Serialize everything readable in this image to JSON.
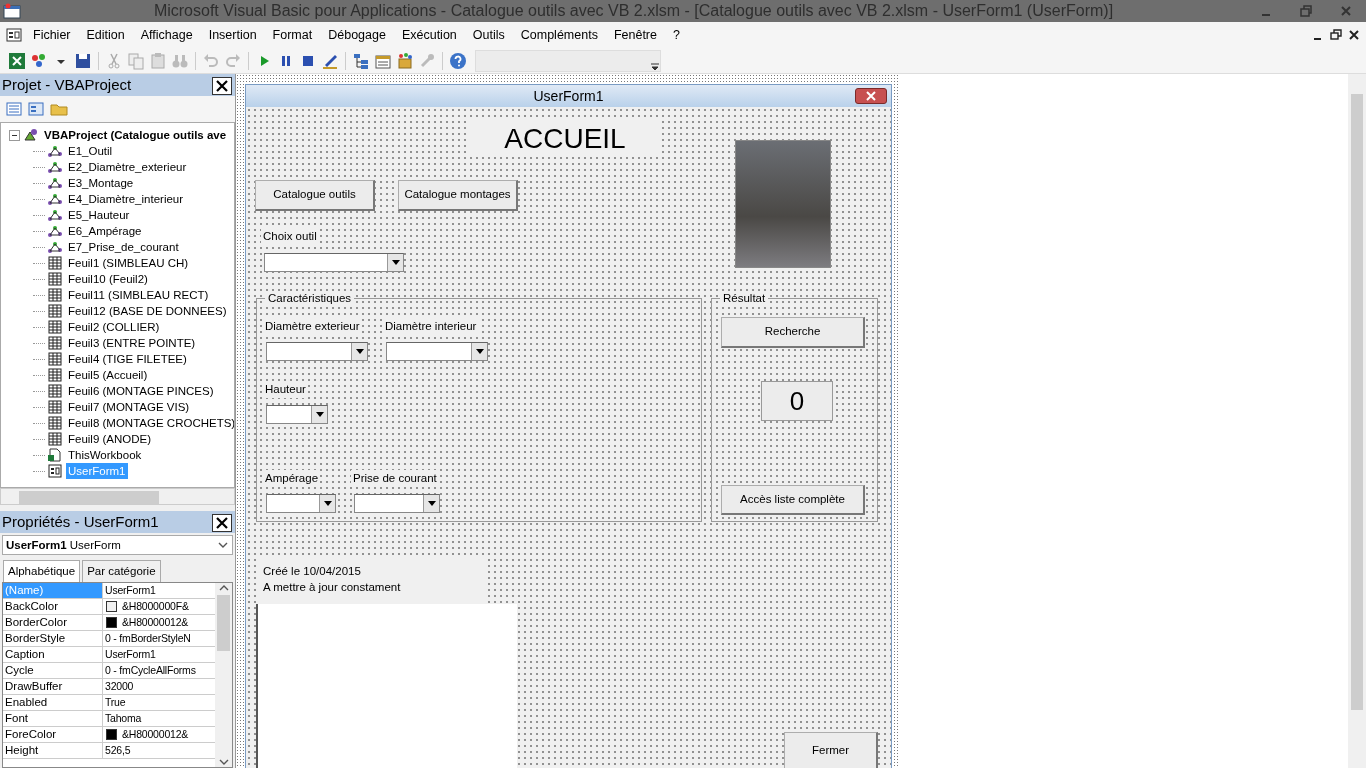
{
  "window": {
    "title": "Microsoft Visual Basic pour Applications - Catalogue outils avec VB 2.xlsm - [Catalogue outils avec VB 2.xlsm - UserForm1 (UserForm)]"
  },
  "menu": [
    {
      "label": "Fichier"
    },
    {
      "label": "Edition"
    },
    {
      "label": "Affichage"
    },
    {
      "label": "Insertion"
    },
    {
      "label": "Format"
    },
    {
      "label": "Débogage"
    },
    {
      "label": "Exécution"
    },
    {
      "label": "Outils"
    },
    {
      "label": "Compléments"
    },
    {
      "label": "Fenêtre"
    },
    {
      "label": "?"
    }
  ],
  "project_pane": {
    "title": "Projet - VBAProject",
    "tree": [
      {
        "label": "VBAProject (Catalogue outils ave",
        "kind": "project",
        "expanded": true,
        "selected": false,
        "children": [
          {
            "label": "E1_Outil",
            "kind": "chart",
            "selected": false
          },
          {
            "label": "E2_Diamètre_exterieur",
            "kind": "chart",
            "selected": false
          },
          {
            "label": "E3_Montage",
            "kind": "chart",
            "selected": false
          },
          {
            "label": "E4_Diamètre_interieur",
            "kind": "chart",
            "selected": false
          },
          {
            "label": "E5_Hauteur",
            "kind": "chart",
            "selected": false
          },
          {
            "label": "E6_Ampérage",
            "kind": "chart",
            "selected": false
          },
          {
            "label": "E7_Prise_de_courant",
            "kind": "chart",
            "selected": false
          },
          {
            "label": "Feuil1 (SIMBLEAU CH)",
            "kind": "sheet",
            "selected": false
          },
          {
            "label": "Feuil10 (Feuil2)",
            "kind": "sheet",
            "selected": false
          },
          {
            "label": "Feuil11 (SIMBLEAU RECT)",
            "kind": "sheet",
            "selected": false
          },
          {
            "label": "Feuil12 (BASE DE DONNEES)",
            "kind": "sheet",
            "selected": false
          },
          {
            "label": "Feuil2 (COLLIER)",
            "kind": "sheet",
            "selected": false
          },
          {
            "label": "Feuil3 (ENTRE POINTE)",
            "kind": "sheet",
            "selected": false
          },
          {
            "label": "Feuil4 (TIGE FILETEE)",
            "kind": "sheet",
            "selected": false
          },
          {
            "label": "Feuil5 (Accueil)",
            "kind": "sheet",
            "selected": false
          },
          {
            "label": "Feuil6 (MONTAGE PINCES)",
            "kind": "sheet",
            "selected": false
          },
          {
            "label": "Feuil7 (MONTAGE VIS)",
            "kind": "sheet",
            "selected": false
          },
          {
            "label": "Feuil8 (MONTAGE CROCHETS)",
            "kind": "sheet",
            "selected": false
          },
          {
            "label": "Feuil9 (ANODE)",
            "kind": "sheet",
            "selected": false
          },
          {
            "label": "ThisWorkbook",
            "kind": "workbook",
            "selected": false
          },
          {
            "label": "UserForm1",
            "kind": "form",
            "selected": true
          }
        ]
      }
    ]
  },
  "properties": {
    "title": "Propriétés - UserForm1",
    "object_name": "UserForm1",
    "object_type": "UserForm",
    "tabs": [
      {
        "label": "Alphabétique",
        "selected": true
      },
      {
        "label": "Par catégorie",
        "selected": false
      }
    ],
    "rows": [
      {
        "name": "(Name)",
        "value": "UserForm1",
        "selected": true
      },
      {
        "name": "BackColor",
        "value": "&H8000000F&",
        "color": "#f0f0f0",
        "selected": false
      },
      {
        "name": "BorderColor",
        "value": "&H80000012&",
        "color": "#000000",
        "selected": false
      },
      {
        "name": "BorderStyle",
        "value": "0 - fmBorderStyleN",
        "selected": false
      },
      {
        "name": "Caption",
        "value": "UserForm1",
        "selected": false
      },
      {
        "name": "Cycle",
        "value": "0 - fmCycleAllForms",
        "selected": false
      },
      {
        "name": "DrawBuffer",
        "value": "32000",
        "selected": false
      },
      {
        "name": "Enabled",
        "value": "True",
        "selected": false
      },
      {
        "name": "Font",
        "value": "Tahoma",
        "selected": false
      },
      {
        "name": "ForeColor",
        "value": "&H80000012&",
        "color": "#000000",
        "selected": false
      },
      {
        "name": "Height",
        "value": "526,5",
        "selected": false
      }
    ]
  },
  "form": {
    "title": "UserForm1",
    "heading": "ACCUEIL",
    "nav_buttons": [
      "Catalogue outils",
      "Catalogue montages"
    ],
    "tool_choice": {
      "label": "Choix outil"
    },
    "characteristics": {
      "caption": "Caractéristiques",
      "fields": [
        {
          "label": "Diamètre exterieur"
        },
        {
          "label": "Diamètre interieur"
        },
        {
          "label": "Hauteur"
        },
        {
          "label": "Ampérage"
        },
        {
          "label": "Prise de courant"
        }
      ]
    },
    "result": {
      "caption": "Résultat",
      "search_button": "Recherche",
      "count": "0",
      "list_button": "Accès liste complète"
    },
    "notes": [
      "Créé le 10/04/2015",
      "A mettre à jour constament"
    ],
    "close_button": "Fermer"
  }
}
